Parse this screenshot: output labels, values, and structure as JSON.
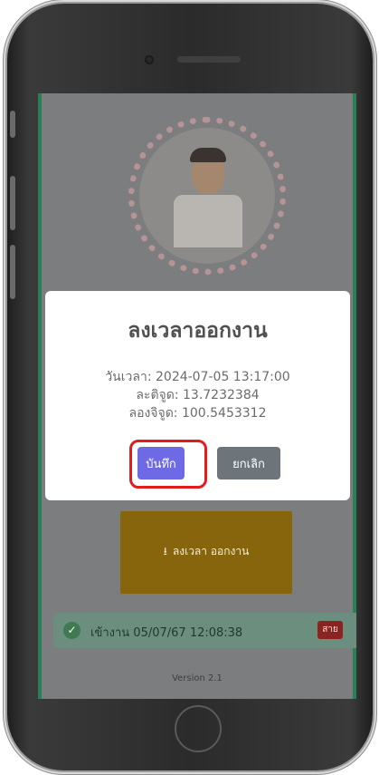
{
  "modal": {
    "title": "ลงเวลาออกงาน",
    "datetime_line": "วันเวลา: 2024-07-05 13:17:00",
    "latitude_line": "ละติจูด: 13.7232384",
    "longitude_line": "ลองจิจูด: 100.5453312",
    "save_label": "บันทึก",
    "cancel_label": "ยกเลิก"
  },
  "checkout_button": {
    "label": "ลงเวลา ออกงาน",
    "icon": "download-icon"
  },
  "status": {
    "text": "เข้างาน 05/07/67 12:08:38",
    "badge": "สาย",
    "icon": "check-circle-icon"
  },
  "version": "Version 2.1",
  "colors": {
    "save": "#6e6ae6",
    "cancel": "#6d757b",
    "checkout": "#86650d",
    "late_badge": "#8b2420",
    "highlight": "#e21c1c"
  }
}
